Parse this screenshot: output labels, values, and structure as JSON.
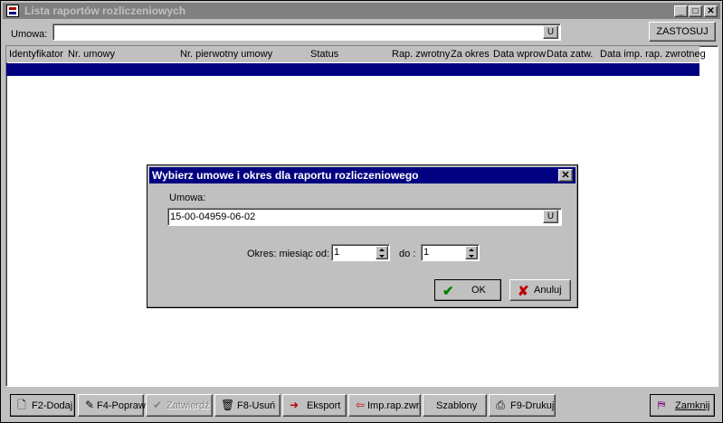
{
  "window": {
    "title": "Lista raportów rozliczeniowych"
  },
  "filter": {
    "label": "Umowa:",
    "value": "",
    "u_label": "U",
    "apply_label": "ZASTOSUJ"
  },
  "grid": {
    "columns": [
      "Identyfikator",
      "Nr. umowy",
      "Nr. pierwotny umowy",
      "Status",
      "Rap. zwrotny",
      "Za okres",
      "Data wprow",
      "Data zatw.",
      "Data imp. rap. zwrotneg"
    ]
  },
  "dialog": {
    "title": "Wybierz umowe i okres dla raportu rozliczeniowego",
    "close_glyph": "✕",
    "umowa_label": "Umowa:",
    "umowa_value": "15-00-04959-06-02",
    "u_label": "U",
    "okres_label": "Okres: miesiąc od:",
    "od_value": "1",
    "do_label": "do :",
    "do_value": "1",
    "ok_label": "OK",
    "cancel_label": "Anuluj"
  },
  "toolbar": {
    "add": "F2-Dodaj",
    "edit": "F4-Popraw",
    "approve": "Zatwierdź",
    "delete": "F8-Usuń",
    "export": "Eksport",
    "import": "Imp.rap.zwr.",
    "templates": "Szablony",
    "print": "F9-Drukuj",
    "close": "Zamknij"
  },
  "colors": {
    "title_inactive": "#808080",
    "title_active": "#000080",
    "selection": "#000080",
    "ok_check": "#008000",
    "cancel_x": "#c00000"
  }
}
